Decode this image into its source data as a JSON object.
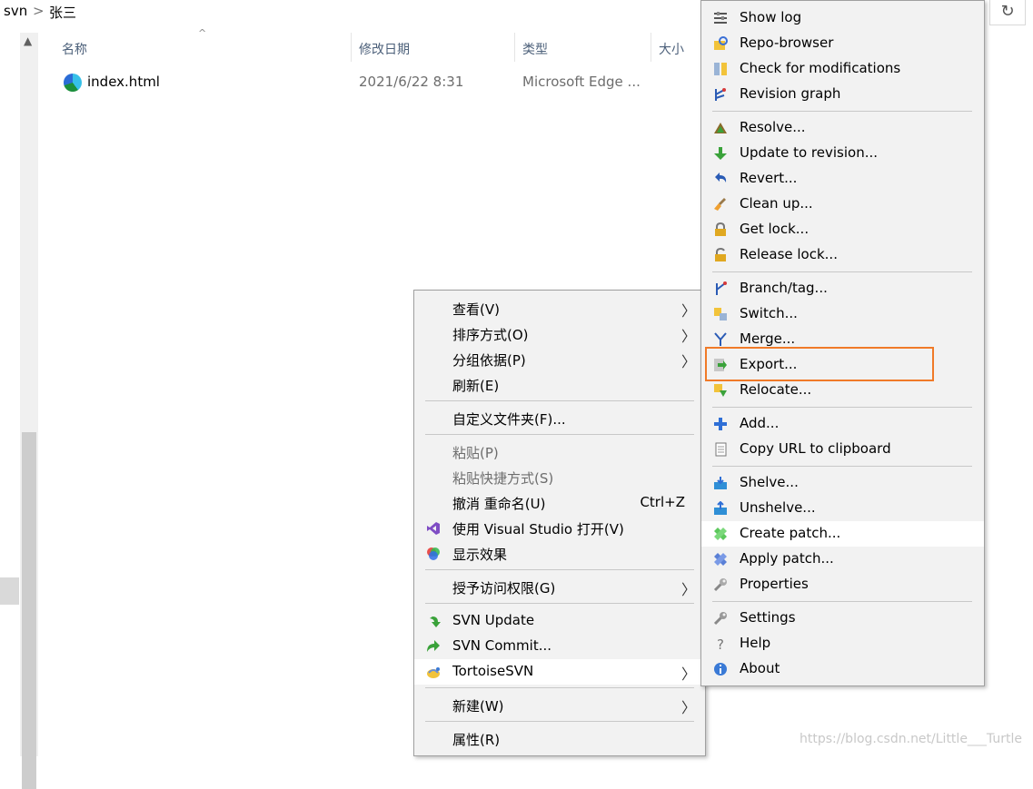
{
  "breadcrumb": {
    "root": "svn",
    "separator": ">",
    "current": "张三"
  },
  "toolbar": {
    "refresh_glyph": "↻"
  },
  "columns": {
    "name": "名称",
    "modified": "修改日期",
    "type": "类型",
    "size": "大小",
    "sort_caret": "^"
  },
  "files": [
    {
      "name": "index.html",
      "modified": "2021/6/22 8:31",
      "type": "Microsoft Edge ...",
      "icon": "edge-file-icon"
    }
  ],
  "explorer_menu": {
    "items": [
      {
        "label": "查看(V)",
        "submenu": true
      },
      {
        "label": "排序方式(O)",
        "submenu": true
      },
      {
        "label": "分组依据(P)",
        "submenu": true
      },
      {
        "label": "刷新(E)"
      },
      {
        "label": "自定义文件夹(F)..."
      },
      {
        "label": "粘贴(P)",
        "disabled": true
      },
      {
        "label": "粘贴快捷方式(S)",
        "disabled": true
      },
      {
        "label": "撤消 重命名(U)",
        "accelerator": "Ctrl+Z"
      },
      {
        "label": "使用 Visual Studio 打开(V)",
        "icon": "visual-studio-icon"
      },
      {
        "label": "显示效果",
        "icon": "color-wheel-icon"
      },
      {
        "label": "授予访问权限(G)",
        "submenu": true
      },
      {
        "label": "SVN Update",
        "icon": "svn-update-icon"
      },
      {
        "label": "SVN Commit...",
        "icon": "svn-commit-icon"
      },
      {
        "label": "TortoiseSVN",
        "icon": "tortoisesvn-icon",
        "submenu": true,
        "highlighted": true
      },
      {
        "label": "新建(W)",
        "submenu": true
      },
      {
        "label": "属性(R)"
      }
    ],
    "submenu_glyph": "〉"
  },
  "svn_menu": {
    "items": [
      {
        "label": "Show log",
        "icon": "show-log-icon"
      },
      {
        "label": "Repo-browser",
        "icon": "repo-browser-icon"
      },
      {
        "label": "Check for modifications",
        "icon": "check-modifications-icon"
      },
      {
        "label": "Revision graph",
        "icon": "revision-graph-icon"
      },
      {
        "label": "Resolve...",
        "icon": "resolve-icon"
      },
      {
        "label": "Update to revision...",
        "icon": "update-revision-icon"
      },
      {
        "label": "Revert...",
        "icon": "revert-icon"
      },
      {
        "label": "Clean up...",
        "icon": "cleanup-icon"
      },
      {
        "label": "Get lock...",
        "icon": "lock-icon"
      },
      {
        "label": "Release lock...",
        "icon": "unlock-icon"
      },
      {
        "label": "Branch/tag...",
        "icon": "branch-icon"
      },
      {
        "label": "Switch...",
        "icon": "switch-icon"
      },
      {
        "label": "Merge...",
        "icon": "merge-icon"
      },
      {
        "label": "Export...",
        "icon": "export-icon",
        "boxed": true
      },
      {
        "label": "Relocate...",
        "icon": "relocate-icon"
      },
      {
        "label": "Add...",
        "icon": "add-icon"
      },
      {
        "label": "Copy URL to clipboard",
        "icon": "copy-url-icon"
      },
      {
        "label": "Shelve...",
        "icon": "shelve-icon"
      },
      {
        "label": "Unshelve...",
        "icon": "unshelve-icon"
      },
      {
        "label": "Create patch...",
        "icon": "create-patch-icon",
        "highlighted": true
      },
      {
        "label": "Apply patch...",
        "icon": "apply-patch-icon"
      },
      {
        "label": "Properties",
        "icon": "properties-icon"
      },
      {
        "label": "Settings",
        "icon": "settings-icon"
      },
      {
        "label": "Help",
        "icon": "help-icon"
      },
      {
        "label": "About",
        "icon": "about-icon"
      }
    ]
  },
  "colors": {
    "highlight_box": "#f07a28",
    "menu_bg": "#f2f2f2",
    "header_text": "#4c607a"
  },
  "watermark": "https://blog.csdn.net/Little___Turtle"
}
